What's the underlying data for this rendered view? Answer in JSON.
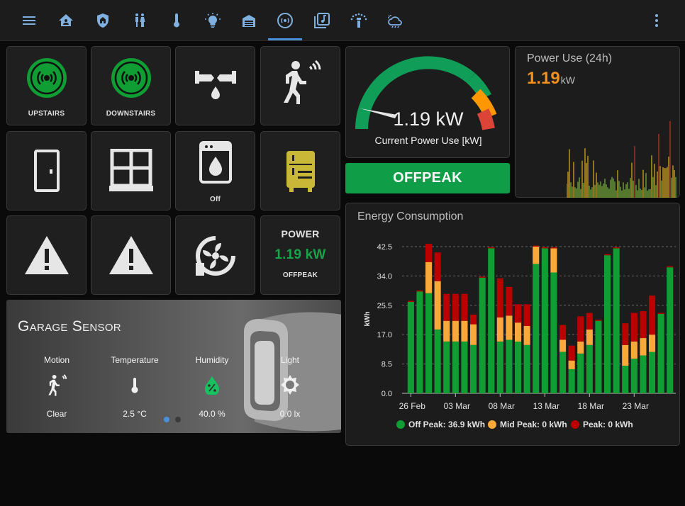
{
  "topbar": {
    "icons": [
      "menu-icon",
      "home-icon",
      "shield-home-icon",
      "people-icon",
      "thermometer-icon",
      "lightbulb-icon",
      "garage-icon",
      "sensor-icon",
      "music-icon",
      "sprinkler-icon",
      "weather-icon",
      "more-vert-icon"
    ],
    "active_tab": "sensor-icon"
  },
  "tiles": {
    "upstairs_label": "UPSTAIRS",
    "downstairs_label": "DOWNSTAIRS",
    "washer_state": "Off",
    "power_title": "POWER",
    "power_value": "1.19 kW",
    "power_mode": "OFFPEAK"
  },
  "gauge": {
    "value_text": "1.19 kW",
    "label": "Current Power Use [kW]",
    "value": 1.19,
    "colors": {
      "green": "#0f9d58",
      "orange": "#ff9800",
      "red": "#db4437"
    }
  },
  "offpeak_button": {
    "label": "OFFPEAK"
  },
  "power_use": {
    "title": "Power Use (24h)",
    "value": "1.19",
    "unit": "kW",
    "accent": "#f0901e"
  },
  "garage": {
    "title": "Garage Sensor",
    "sensors": [
      {
        "name": "Motion",
        "value": "Clear",
        "icon": "motion-icon"
      },
      {
        "name": "Temperature",
        "value": "2.5 °C",
        "icon": "thermometer-icon"
      },
      {
        "name": "Humidity",
        "value": "40.0 %",
        "icon": "water-percent-icon"
      },
      {
        "name": "Light",
        "value": "0.0 lx",
        "icon": "brightness-icon"
      }
    ]
  },
  "chart_data": {
    "type": "bar",
    "title": "Energy Consumption",
    "ylabel": "kWh",
    "ylim": [
      0,
      42.5
    ],
    "yticks": [
      "0.0",
      "8.5",
      "17.0",
      "25.5",
      "34.0",
      "42.5"
    ],
    "xtick_labels": [
      "26 Feb",
      "03 Mar",
      "08 Mar",
      "13 Mar",
      "18 Mar",
      "23 Mar"
    ],
    "stacked": true,
    "series": [
      {
        "name": "Off Peak",
        "color": "#0f9d34",
        "values": [
          26.5,
          29.5,
          29,
          18.5,
          15,
          15,
          15,
          14,
          33.5,
          42,
          15,
          15.5,
          15,
          14,
          37.5,
          42,
          35,
          12,
          7,
          11.5,
          14,
          21,
          40,
          42,
          8,
          10,
          11,
          12,
          23,
          36.5
        ]
      },
      {
        "name": "Mid Peak",
        "color": "#f9a83a",
        "values": [
          0,
          0,
          9,
          14,
          6,
          6,
          6,
          6,
          0,
          0,
          7,
          7,
          5.5,
          5.5,
          5,
          0,
          7,
          3.5,
          2.5,
          3.5,
          4.5,
          0,
          0,
          0,
          6,
          5,
          5,
          5,
          0,
          0
        ]
      },
      {
        "name": "Peak",
        "color": "#bb0000",
        "values": [
          0,
          0,
          5,
          8,
          7.5,
          7.5,
          7.5,
          2.5,
          0,
          0,
          11,
          8,
          5,
          6,
          0,
          0,
          0,
          4,
          4,
          7,
          4.5,
          0,
          0,
          0,
          6,
          8,
          7.5,
          11,
          0,
          0
        ]
      }
    ],
    "legend": [
      {
        "label": "Off Peak: 36.9 kWh",
        "color": "#0f9d34"
      },
      {
        "label": "Mid Peak: 0 kWh",
        "color": "#f9a83a"
      },
      {
        "label": "Peak: 0 kWh",
        "color": "#bb0000"
      }
    ],
    "grid": true
  }
}
